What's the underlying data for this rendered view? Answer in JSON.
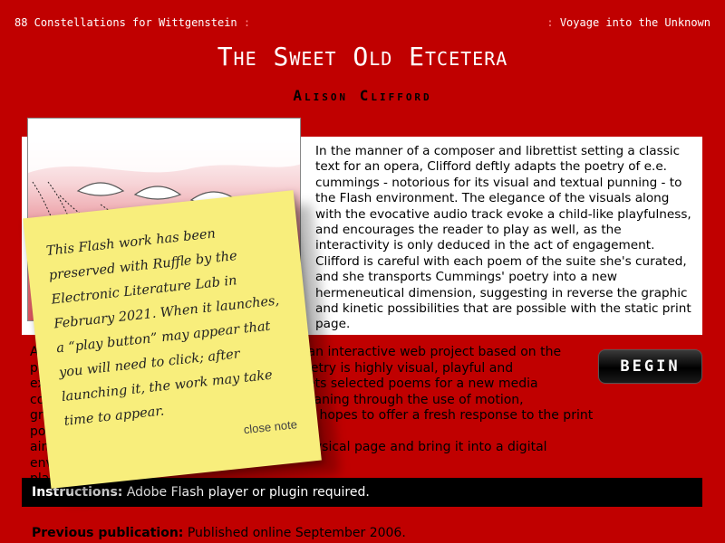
{
  "nav": {
    "previous_label": "88 Constellations for Wittgenstein",
    "next_label": "Voyage into the Unknown",
    "separator": ":"
  },
  "title": "The Sweet Old Etcetera",
  "author": "Alison Clifford",
  "description": "In the manner of a composer and librettist setting a classic text for an opera, Clifford deftly adapts the poetry of e.e. cummings - notorious for its visual and textual punning - to the Flash environment. The elegance of the visuals along with the evocative audio track evoke a child-like playfulness, and encourages the reader to play as well, as the interactivity is only deduced in the act of engagement. Clifford is careful with each poem of the suite she's curated, and she transports Cummings' poetry into a new hermeneutical dimension, suggesting in reverse the graphic and kinetic possibilities that are possible with the static print page.",
  "body_lines": [
    "A",
    "n is an interactive web project based on the",
    "po",
    "poetry is highly visual, playful and",
    "ex",
    "prets selected poems for a new media",
    "co",
    "meaning through the use of motion,",
    "gra",
    "ect hopes to offer a fresh response to the print poetry,",
    "aim",
    "physical page and bring it into a digital environment in a",
    "pla"
  ],
  "begin_label": "BEGIN",
  "instructions": {
    "label": "Instructions:",
    "text": "Adobe Flash player or plugin required."
  },
  "previous_publication": {
    "label": "Previous publication:",
    "text": "Published online September 2006."
  },
  "note": {
    "text": "This Flash work has been preserved with Ruffle by the Electronic Literature Lab in February 2021. When it launches, a “play button” may appear that you will need to click; after launching it, the work may take time to appear.",
    "close_label": "close note"
  },
  "colors": {
    "background": "#c00000",
    "note": "#f8ee7c",
    "instructions_bar": "#000000"
  }
}
